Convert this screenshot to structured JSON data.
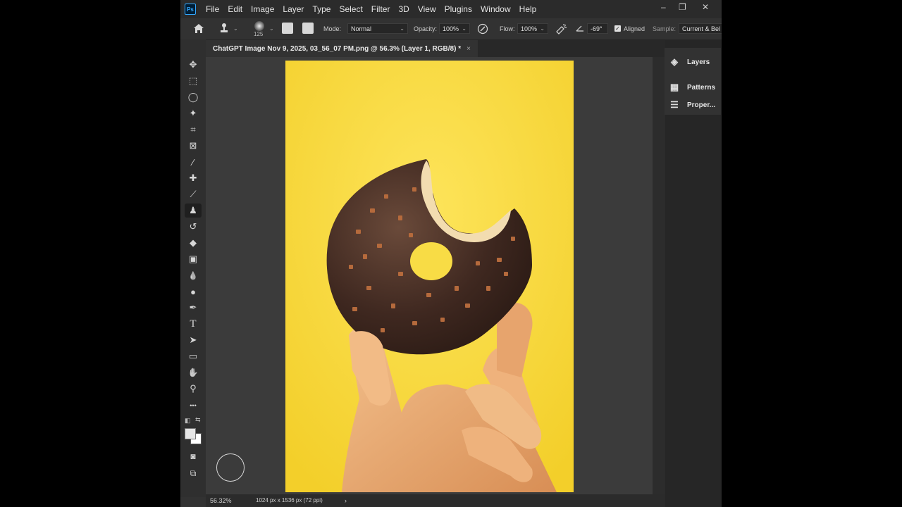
{
  "app": {
    "logo": "Ps"
  },
  "menu": [
    "File",
    "Edit",
    "Image",
    "Layer",
    "Type",
    "Select",
    "Filter",
    "3D",
    "View",
    "Plugins",
    "Window",
    "Help"
  ],
  "window_controls": {
    "minimize": "–",
    "restore": "❐",
    "close": "✕"
  },
  "options": {
    "brush_size": "125",
    "mode_label": "Mode:",
    "mode_value": "Normal",
    "opacity_label": "Opacity:",
    "opacity_value": "100%",
    "flow_label": "Flow:",
    "flow_value": "100%",
    "angle_value": "-69°",
    "aligned_label": "Aligned",
    "aligned_checked": true,
    "sample_label": "Sample:",
    "sample_value": "Current & Bel"
  },
  "document": {
    "tab_title": "ChatGPT Image Nov 9, 2025, 03_56_07 PM.png @ 56.3% (Layer 1, RGB/8) *",
    "close_icon": "×"
  },
  "tools": [
    {
      "name": "move-tool-icon",
      "glyph": "✥"
    },
    {
      "name": "marquee-tool-icon",
      "glyph": "⬚"
    },
    {
      "name": "lasso-tool-icon",
      "glyph": "◯"
    },
    {
      "name": "magic-wand-tool-icon",
      "glyph": "✦"
    },
    {
      "name": "crop-tool-icon",
      "glyph": "⌗"
    },
    {
      "name": "frame-tool-icon",
      "glyph": "⊠"
    },
    {
      "name": "eyedropper-tool-icon",
      "glyph": "⁄"
    },
    {
      "name": "healing-brush-tool-icon",
      "glyph": "✚"
    },
    {
      "name": "brush-tool-icon",
      "glyph": "⟋"
    },
    {
      "name": "clone-stamp-tool-icon",
      "glyph": "♟",
      "active": true
    },
    {
      "name": "history-brush-tool-icon",
      "glyph": "↺"
    },
    {
      "name": "eraser-tool-icon",
      "glyph": "◆"
    },
    {
      "name": "gradient-tool-icon",
      "glyph": "▣"
    },
    {
      "name": "blur-tool-icon",
      "glyph": "💧"
    },
    {
      "name": "dodge-tool-icon",
      "glyph": "●"
    },
    {
      "name": "pen-tool-icon",
      "glyph": "✒"
    },
    {
      "name": "type-tool-icon",
      "glyph": "T"
    },
    {
      "name": "path-selection-tool-icon",
      "glyph": "➤"
    },
    {
      "name": "rectangle-tool-icon",
      "glyph": "▭"
    },
    {
      "name": "hand-tool-icon",
      "glyph": "✋"
    },
    {
      "name": "zoom-tool-icon",
      "glyph": "⚲"
    },
    {
      "name": "more-tools-icon",
      "glyph": "•••"
    }
  ],
  "colors": {
    "foreground": "#e6e6e6",
    "background": "#ffffff",
    "canvas_bg": "#f7d83a",
    "accent": "#31a8ff"
  },
  "panels": [
    {
      "name": "layers-panel-button",
      "icon": "layers-icon",
      "glyph": "◈",
      "label": "Layers"
    },
    {
      "name": "patterns-panel-button",
      "icon": "patterns-icon",
      "glyph": "▦",
      "label": "Patterns"
    },
    {
      "name": "properties-panel-button",
      "icon": "properties-icon",
      "glyph": "☰",
      "label": "Proper..."
    }
  ],
  "status": {
    "zoom": "56.32%",
    "doc_info": "1024 px x 1536 px (72 ppi)",
    "arrow": "›"
  }
}
